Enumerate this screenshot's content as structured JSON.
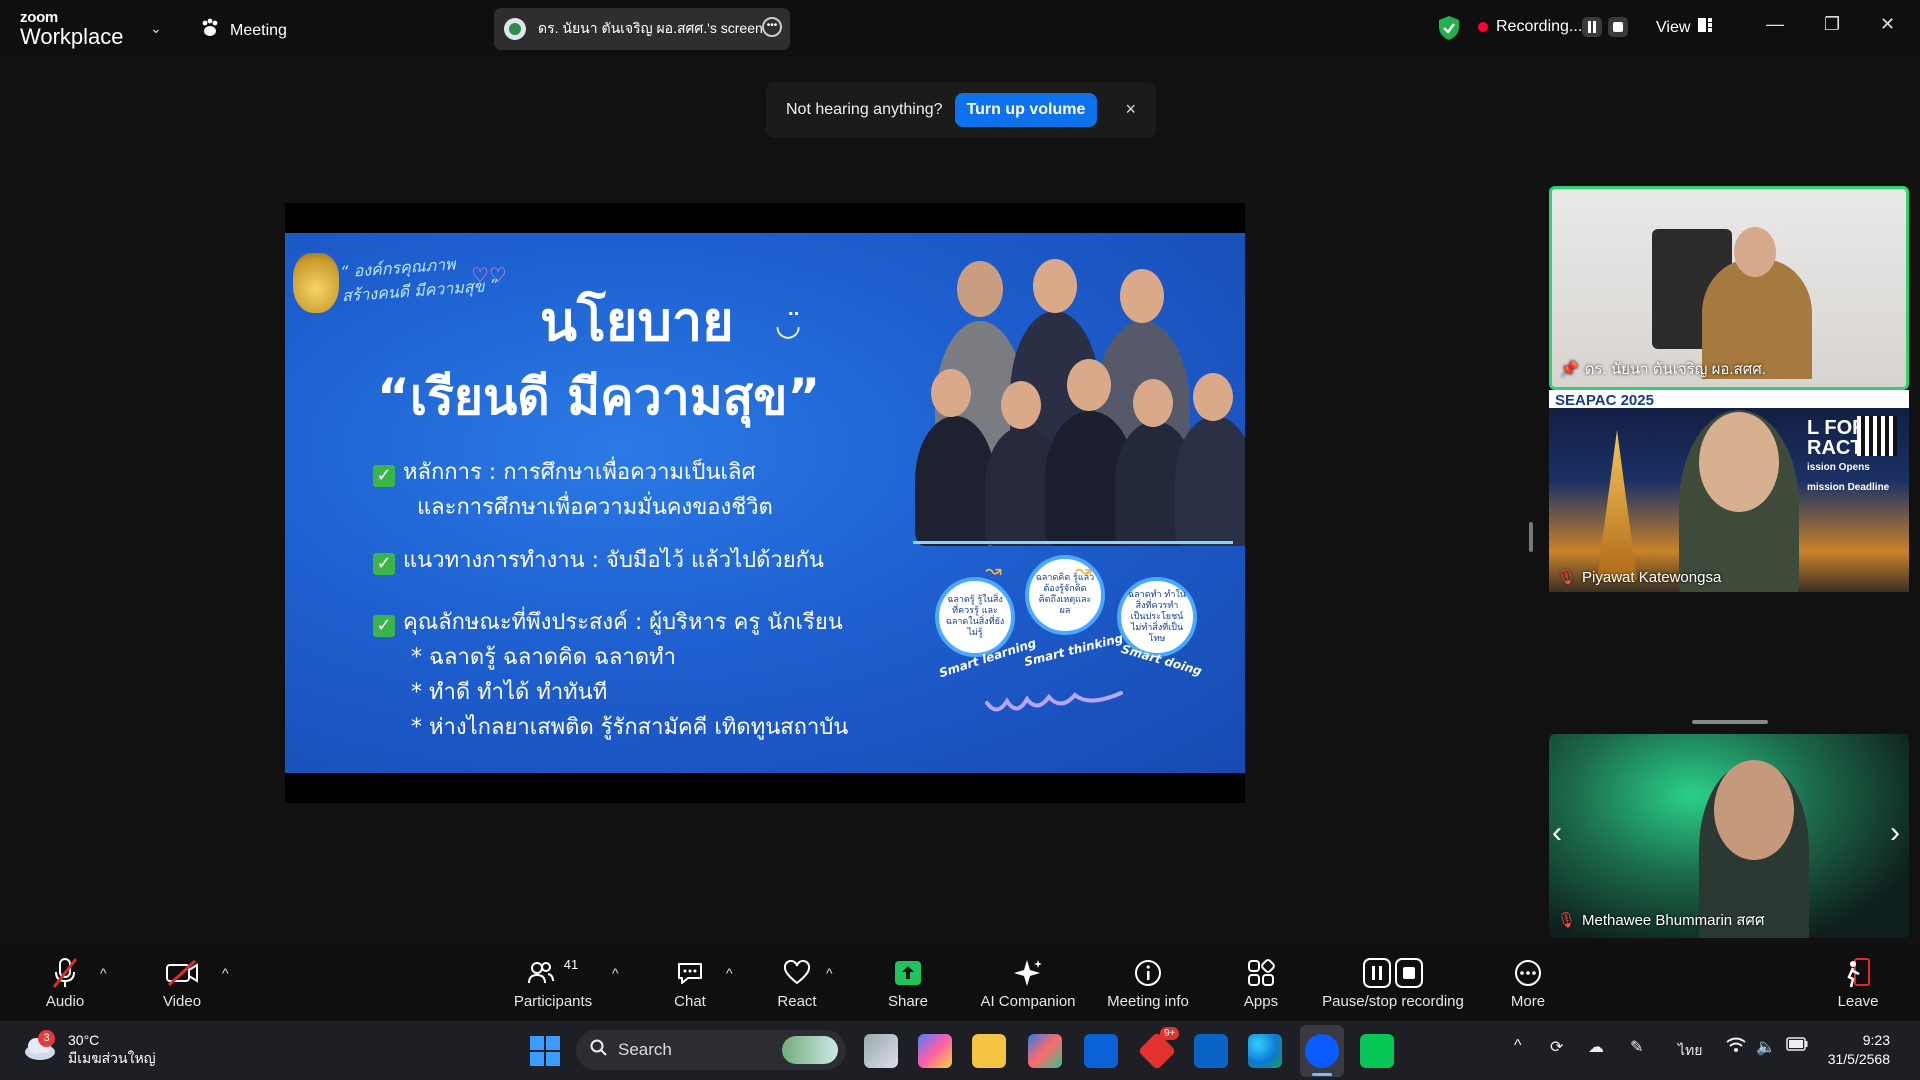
{
  "topbar": {
    "brand_small": "zoom",
    "brand_large": "Workplace",
    "meeting_label": "Meeting",
    "share_label": "ดร. นัยนา ตันเจริญ ผอ.สศศ.'s screen",
    "recording_label": "Recording...",
    "view_label": "View"
  },
  "volume_popup": {
    "message": "Not hearing anything?",
    "button": "Turn up volume",
    "close": "×"
  },
  "slide": {
    "motto_line1": "“ องค์กรคุณภาพ",
    "motto_line2": "สร้างคนดี มีความสุข ”",
    "title1": "นโยบาย",
    "title2": "“เรียนดี มีความสุข”",
    "bullet1_a": "หลักการ : การศึกษาเพื่อความเป็นเลิศ",
    "bullet1_b": "และการศึกษาเพื่อความมั่นคงของชีวิต",
    "bullet2": "แนวทางการทำงาน : จับมือไว้ แล้วไปด้วยกัน",
    "bullet3": "คุณลักษณะที่พึงประสงค์ : ผู้บริหาร  ครู   นักเรียน",
    "sub1": "* ฉลาดรู้ ฉลาดคิด ฉลาดทำ",
    "sub2": "* ทำดี ทำได้ ทำทันที",
    "sub3": "* ห่างไกลยาเสพติด รู้รักสามัคคี  เทิดทูนสถาบัน",
    "circle1": "ฉลาดรู้ รู้ในสิ่งที่ควรรู้ และฉลาดในสิ่งที่ยังไม่รู้",
    "circle2": "ฉลาดคิด รู้แล้วต้องรู้จักคิด คิดถึงเหตุและผล",
    "circle3": "ฉลาดทำ ทำในสิ่งที่ควรทำ เป็นประโยชน์ ไม่ทำสิ่งที่เป็นโทษ",
    "smart1": "Smart learning",
    "smart2": "Smart thinking",
    "smart3": "Smart doing"
  },
  "tiles": {
    "t1_name": "ดร. นัยนา ตันเจริญ ผอ.สศศ.",
    "t2_name": "Piyawat Katewongsa",
    "t2_banner": "SEAPAC 2025",
    "t2_overlay1": "L FOR",
    "t2_overlay2": "RACT",
    "t2_overlay3": "ission Opens",
    "t2_overlay4": "mission Deadline",
    "t3_name": "Methawee Bhummarin สศศ"
  },
  "toolbar": {
    "audio": "Audio",
    "video": "Video",
    "participants": "Participants",
    "participants_count": "41",
    "chat": "Chat",
    "react": "React",
    "share": "Share",
    "ai": "AI Companion",
    "info": "Meeting info",
    "apps": "Apps",
    "pause": "Pause/stop recording",
    "more": "More",
    "leave": "Leave"
  },
  "taskbar": {
    "temp": "30°C",
    "weather_desc": "มีเมฆส่วนใหญ่",
    "weather_badge": "3",
    "search": "Search",
    "lang": "ไทย",
    "time": "9:23",
    "date": "31/5/2568",
    "notif_badge": "9+"
  },
  "colors": {
    "accent_blue": "#0e72ed",
    "speaker_green": "#2fd36d",
    "record_red": "#ff0033"
  }
}
